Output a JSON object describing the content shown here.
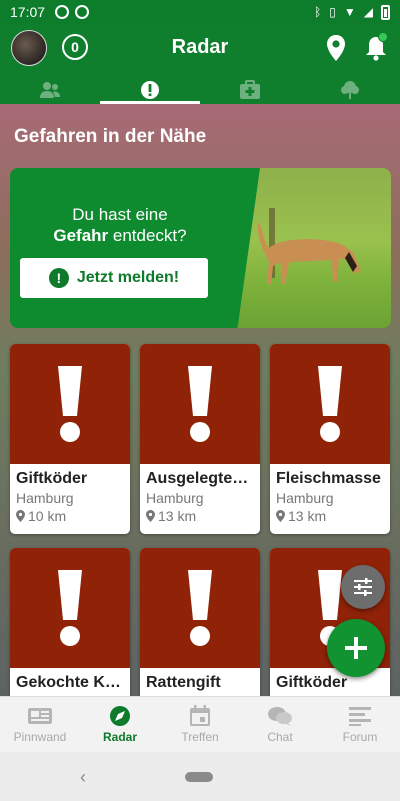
{
  "status_bar": {
    "time": "17:07"
  },
  "app_bar": {
    "title": "Radar",
    "count": "0"
  },
  "tabs": [
    {
      "icon": "people-icon",
      "active": false
    },
    {
      "icon": "alert-icon",
      "active": true
    },
    {
      "icon": "first-aid-icon",
      "active": false
    },
    {
      "icon": "tree-icon",
      "active": false
    }
  ],
  "section": {
    "title": "Gefahren in der Nähe"
  },
  "banner": {
    "line1": "Du hast eine",
    "bold": "Gefahr",
    "line2_rest": " entdeckt?",
    "button_label": "Jetzt melden!"
  },
  "cards": [
    {
      "title": "Giftköder",
      "city": "Hamburg",
      "distance": "10 km"
    },
    {
      "title": "Ausgelegtes...",
      "city": "Hamburg",
      "distance": "13 km"
    },
    {
      "title": "Fleischmasse",
      "city": "Hamburg",
      "distance": "13 km"
    },
    {
      "title": "Gekochte Kn...",
      "city": "",
      "distance": ""
    },
    {
      "title": "Rattengift",
      "city": "",
      "distance": ""
    },
    {
      "title": "Giftköder",
      "city": "",
      "distance": ""
    }
  ],
  "bottom_nav": [
    {
      "label": "Pinnwand",
      "icon": "newspaper-icon",
      "active": false
    },
    {
      "label": "Radar",
      "icon": "compass-icon",
      "active": true
    },
    {
      "label": "Treffen",
      "icon": "calendar-icon",
      "active": false
    },
    {
      "label": "Chat",
      "icon": "chat-icon",
      "active": false
    },
    {
      "label": "Forum",
      "icon": "forum-icon",
      "active": false
    }
  ],
  "colors": {
    "primary_green": "#0f7f2e",
    "card_red": "#8f2207",
    "fab_green": "#119332"
  }
}
